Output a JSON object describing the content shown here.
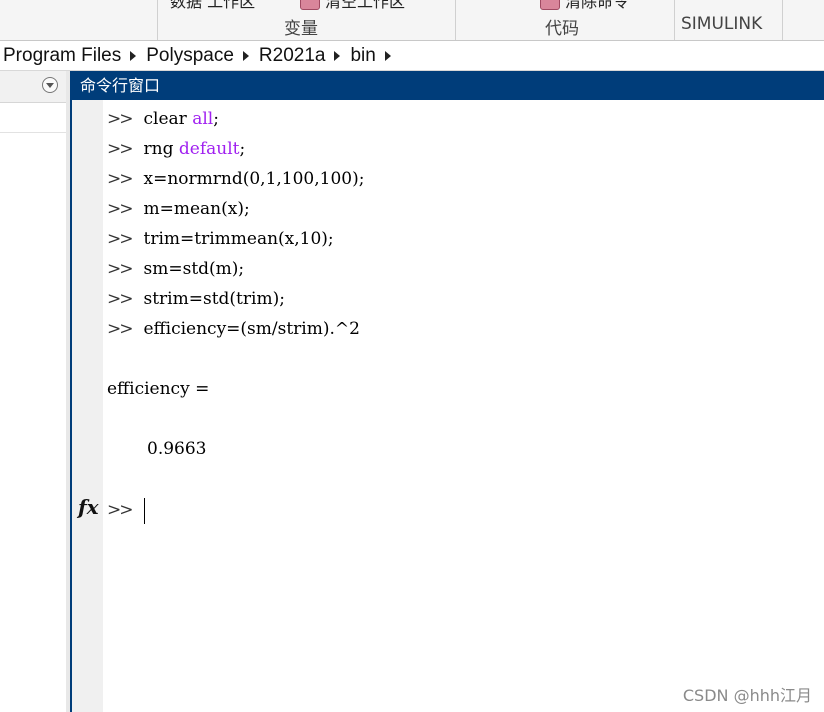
{
  "ribbon": {
    "clipped_left": "数据  工作区",
    "clipped_mid": "清空工作区",
    "clipped_right": "清除命令",
    "groups": [
      "变量",
      "代码",
      "SIMULINK"
    ]
  },
  "path": [
    "Program Files",
    "Polyspace",
    "R2021a",
    "bin"
  ],
  "command_window": {
    "title": "命令行窗口",
    "prompt": ">>",
    "fx_label": "fx",
    "lines": [
      {
        "cmd": "clear ",
        "kw": "all",
        "tail": ";"
      },
      {
        "cmd": "rng ",
        "kw": "default",
        "tail": ";"
      },
      {
        "cmd": "x=normrnd(0,1,100,100);",
        "kw": "",
        "tail": ""
      },
      {
        "cmd": "m=mean(x);",
        "kw": "",
        "tail": ""
      },
      {
        "cmd": "trim=trimmean(x,10);",
        "kw": "",
        "tail": ""
      },
      {
        "cmd": "sm=std(m);",
        "kw": "",
        "tail": ""
      },
      {
        "cmd": "strim=std(trim);",
        "kw": "",
        "tail": ""
      },
      {
        "cmd": "efficiency=(sm/strim).^2",
        "kw": "",
        "tail": ""
      }
    ],
    "output_label": "efficiency =",
    "output_value": "0.9663"
  },
  "watermark": "CSDN @hhh江月",
  "colors": {
    "title_bar": "#003d7a",
    "keyword": "#a020f0"
  }
}
